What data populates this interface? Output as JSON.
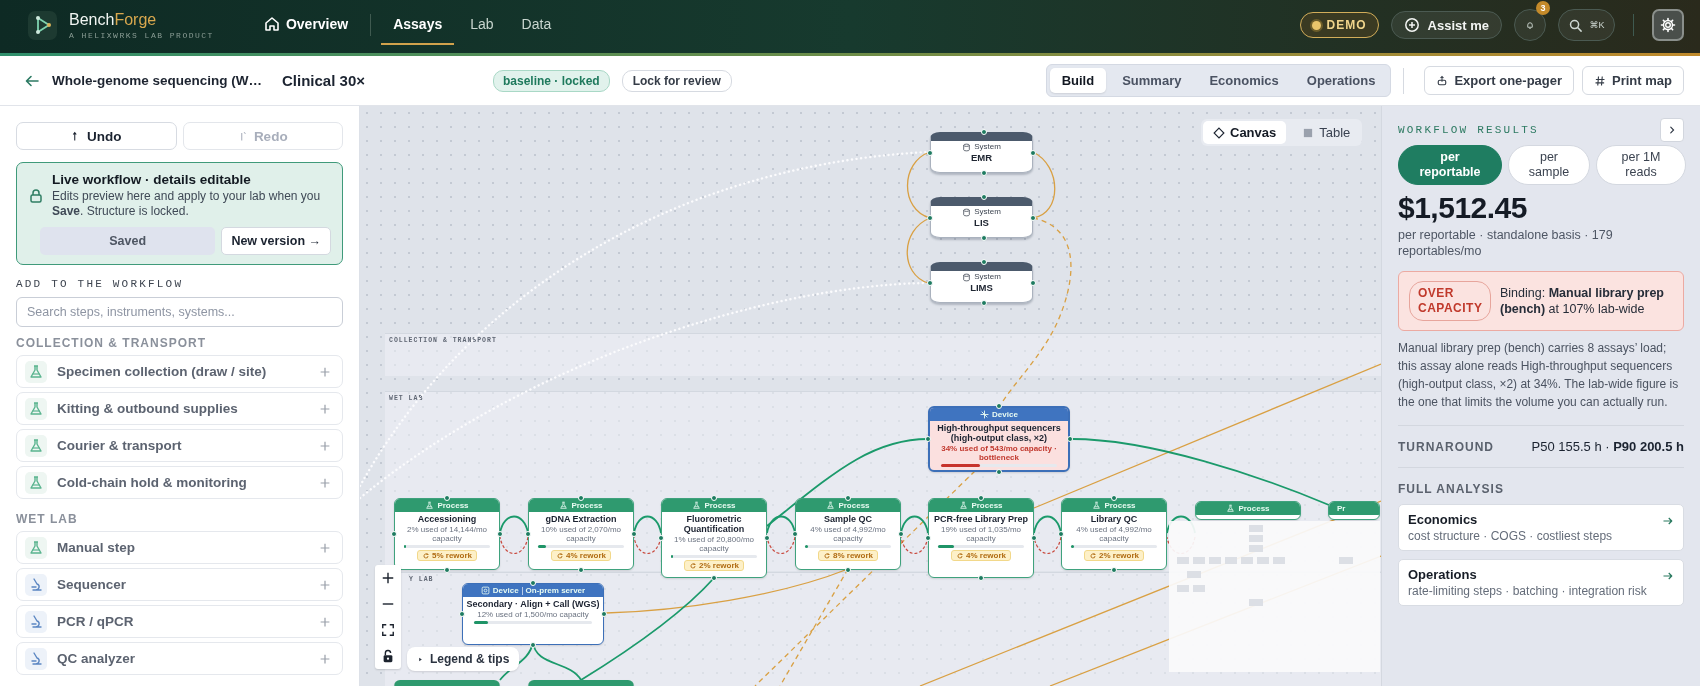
{
  "app": {
    "brand": {
      "name_lead": "Bench",
      "name_accent": "Forge",
      "tagline": "A HELIXWRKS LAB PRODUCT"
    },
    "nav": [
      {
        "label": "Overview",
        "kind": "home",
        "selected": false
      },
      {
        "label": "Assays",
        "kind": "page",
        "selected": true
      },
      {
        "label": "Lab",
        "kind": "page",
        "selected": false
      },
      {
        "label": "Data",
        "kind": "page",
        "selected": false
      }
    ],
    "demo_badge": "DEMO",
    "assist_button": "Assist me",
    "notifications": {
      "count": "3"
    },
    "search": {
      "shortcut": "⌘K"
    }
  },
  "toolbar": {
    "assay_name": "Whole-genome sequencing (W…",
    "variant": "Clinical 30×",
    "status_chip": "baseline · locked",
    "lock_button": "Lock for review",
    "tabs": [
      {
        "label": "Build",
        "selected": true
      },
      {
        "label": "Summary",
        "selected": false
      },
      {
        "label": "Economics",
        "selected": false
      },
      {
        "label": "Operations",
        "selected": false
      }
    ],
    "actions": [
      {
        "label": "Export one-pager",
        "kind": "export"
      },
      {
        "label": "Print map",
        "kind": "print"
      }
    ]
  },
  "sidebar": {
    "undo": {
      "label": "Undo",
      "disabled": false
    },
    "redo": {
      "label": "Redo",
      "disabled": true
    },
    "notice": {
      "title": "Live workflow · details editable",
      "text": "Edits preview here and apply to your lab when you **Save**. Structure is locked.",
      "save_button": {
        "label": "Saved",
        "disabled": true
      },
      "version_button": "New version →"
    },
    "add_heading": "ADD TO THE WORKFLOW",
    "search": {
      "placeholder": "Search steps, instruments, systems..."
    },
    "sections": [
      {
        "title": "COLLECTION & TRANSPORT",
        "items": [
          {
            "label": "Specimen collection (draw / site)",
            "kind": "step"
          },
          {
            "label": "Kitting & outbound supplies",
            "kind": "step"
          },
          {
            "label": "Courier & transport",
            "kind": "step"
          },
          {
            "label": "Cold-chain hold & monitoring",
            "kind": "step"
          }
        ]
      },
      {
        "title": "WET LAB",
        "items": [
          {
            "label": "Manual step",
            "kind": "step"
          },
          {
            "label": "Sequencer",
            "kind": "instrument"
          },
          {
            "label": "PCR / qPCR",
            "kind": "instrument"
          },
          {
            "label": "QC analyzer",
            "kind": "instrument"
          }
        ]
      }
    ]
  },
  "canvas": {
    "view_toggle": [
      {
        "label": "Canvas",
        "kind": "canvas",
        "selected": true
      },
      {
        "label": "Table",
        "kind": "table",
        "selected": false
      }
    ],
    "lanes": [
      {
        "label": "COLLECTION & TRANSPORT"
      },
      {
        "label": "WET LAB"
      },
      {
        "label": "Y LAB"
      }
    ],
    "systems": [
      {
        "header": "System",
        "name": "EMR"
      },
      {
        "header": "System",
        "name": "LIS"
      },
      {
        "header": "System",
        "name": "LIMS"
      }
    ],
    "nodes": [
      {
        "kind": "device",
        "header": "Device",
        "title": "High-throughput sequencers (high-output class, ×2)",
        "usage": "34% used of 543/mo capacity · bottleneck",
        "level": 0.34,
        "bottleneck": true
      },
      {
        "kind": "process",
        "header": "Process",
        "title": "Accessioning",
        "usage": "2% used of 14,144/mo capacity",
        "level": 0.02,
        "rework": "5% rework",
        "bottleneck": false
      },
      {
        "kind": "process",
        "header": "Process",
        "title": "gDNA Extraction",
        "usage": "10% used of 2,070/mo capacity",
        "level": 0.1,
        "rework": "4% rework",
        "bottleneck": false
      },
      {
        "kind": "process",
        "header": "Process",
        "title": "Fluorometric Quantification",
        "usage": "1% used of 20,800/mo capacity",
        "level": 0.01,
        "rework": "2% rework",
        "bottleneck": false
      },
      {
        "kind": "process",
        "header": "Process",
        "title": "Sample QC",
        "usage": "4% used of 4,992/mo capacity",
        "level": 0.04,
        "rework": "8% rework",
        "bottleneck": false
      },
      {
        "kind": "process",
        "header": "Process",
        "title": "PCR-free Library Prep",
        "usage": "19% used of 1,035/mo capacity",
        "level": 0.19,
        "rework": "4% rework",
        "bottleneck": false
      },
      {
        "kind": "process",
        "header": "Process",
        "title": "Library QC",
        "usage": "4% used of 4,992/mo capacity",
        "level": 0.04,
        "rework": "2% rework",
        "bottleneck": false
      },
      {
        "kind": "process",
        "header": "Process"
      },
      {
        "kind": "process",
        "header": "Pr"
      },
      {
        "kind": "device",
        "header": "Device",
        "tag": "On-prem server",
        "title": "Secondary · Align + Call (WGS)",
        "usage": "12% used of 1,500/mo capacity",
        "level": 0.12,
        "bottleneck": false
      },
      {
        "kind": "process"
      },
      {
        "kind": "process"
      }
    ],
    "legend_button": "Legend & tips"
  },
  "results": {
    "heading": "WORKFLOW RESULTS",
    "units": [
      {
        "label": "per reportable",
        "selected": true
      },
      {
        "label": "per sample",
        "selected": false
      },
      {
        "label": "per 1M reads",
        "selected": false
      }
    ],
    "price": "$1,512.45",
    "basis": "per reportable · standalone basis · 179 reportables/mo",
    "alert": {
      "over_capacity": true,
      "badge": "OVER CAPACITY",
      "text": "Binding: **Manual library prep (bench)** at 107% lab-wide"
    },
    "explanation": "Manual library prep (bench) carries 8 assays’ load; this assay alone reads High-throughput sequencers (high-output class, ×2) at 34%. The lab-wide figure is the one that limits the volume you can actually run.",
    "turnaround": {
      "label": "TURNAROUND",
      "value": "P50 155.5 h · **P90 200.5 h**"
    },
    "analysis_heading": "FULL ANALYSIS",
    "links": [
      {
        "title": "Economics",
        "subtitle": "cost structure · COGS · costliest steps"
      },
      {
        "title": "Operations",
        "subtitle": "rate-limiting steps · batching · integration risk"
      }
    ]
  }
}
